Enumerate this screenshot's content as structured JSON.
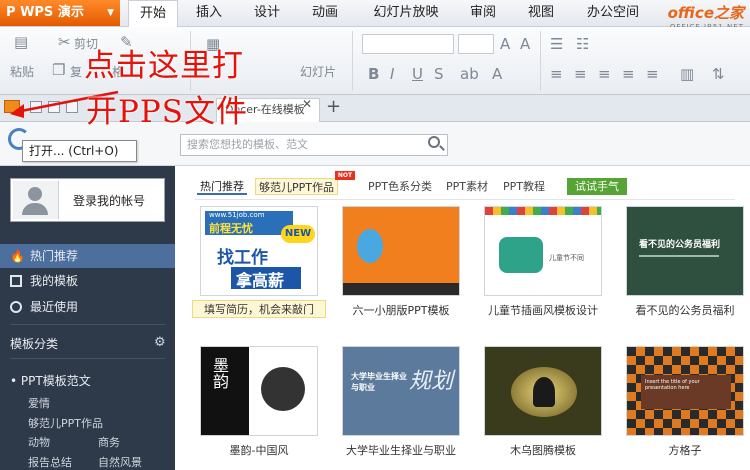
{
  "app": {
    "title": "WPS 演示",
    "logo": "P"
  },
  "menu": [
    "开始",
    "插入",
    "设计",
    "动画",
    "幻灯片放映",
    "审阅",
    "视图",
    "办公空间"
  ],
  "brand": {
    "name": "office之家",
    "url": "OFFICE.JB51.NET"
  },
  "ribbon": {
    "cut": "剪切",
    "paste": "粘贴",
    "copy": "复",
    "format": "格",
    "slide": "幻灯片"
  },
  "tab": {
    "doc_title": "Docer-在线模板",
    "add": "+"
  },
  "tooltip": "打开... (Ctrl+O)",
  "search": {
    "placeholder": "搜索您想找的模板、范文"
  },
  "sidebar": {
    "login": "登录我的帐号",
    "items": [
      "热门推荐",
      "我的模板",
      "最近使用"
    ],
    "section_title": "模板分类",
    "group_title": "PPT模板范文",
    "subs": [
      "爱情",
      "够范儿PPT作品",
      "动物",
      "商务",
      "报告总结",
      "自然风景"
    ]
  },
  "categories": [
    "热门推荐",
    "够范儿PPT作品",
    "PPT色系分类",
    "PPT素材",
    "PPT教程",
    "试试手气"
  ],
  "hot_badge": "NOT",
  "thumb_texts": {
    "t1_site": "www.51job.com",
    "t1_brand": "前程无忧",
    "t1_new": "NEW",
    "t1_line1": "找工作",
    "t1_line2": "拿高薪",
    "t3_label": "儿童节不同",
    "t4_title": "看不见的公务员福利",
    "t5_title": "墨韵",
    "t6_title": "大学毕业生择业与职业",
    "t6_script": "规划",
    "t8_banner": "Insert the title of your presentation here"
  },
  "captions": [
    "填写简历，机会来敲门",
    "六一小朋版PPT模板",
    "儿童节插画风模板设计",
    "看不见的公务员福利",
    "墨韵-中国风",
    "大学毕业生择业与职业",
    "木乌图腾模板",
    "方格子"
  ],
  "annotation": {
    "line1": "点击这里打",
    "line2": "开PPS文件"
  },
  "colors": {
    "accent": "#e35a00",
    "sidebar": "#2e3a4a",
    "annotation": "#e3120b",
    "link": "#3b6ea8"
  }
}
